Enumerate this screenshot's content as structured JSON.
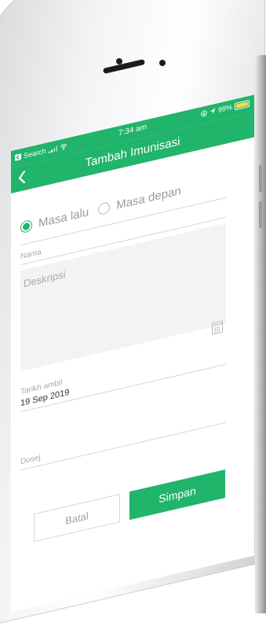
{
  "status_bar": {
    "back_app": "Search",
    "time": "7:34 am",
    "battery_percent": "99%",
    "battery_level": 0.99,
    "battery_color": "#ffdf3a"
  },
  "nav": {
    "back_icon": "chevron-left-icon",
    "title": "Tambah Imunisasi",
    "color": "#21b46b"
  },
  "form": {
    "radio_options": [
      {
        "label": "Masa lalu",
        "selected": true
      },
      {
        "label": "Masa depan",
        "selected": false
      }
    ],
    "nama_label": "Nama",
    "deskripsi_placeholder": "Deskripsi",
    "tarikh_label": "Tarikh ambil",
    "tarikh_value": "19 Sep 2019",
    "dosej_label": "Dosej",
    "calendar_icon": "calendar-icon"
  },
  "buttons": {
    "cancel_label": "Batal",
    "save_label": "Simpan"
  }
}
